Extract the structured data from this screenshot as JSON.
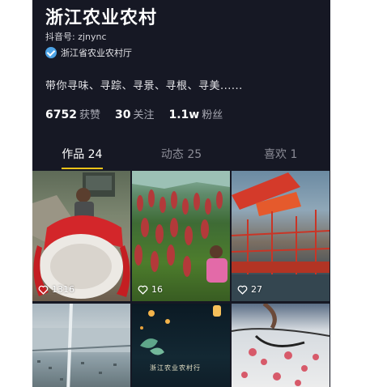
{
  "profile": {
    "name": "浙江农业农村",
    "douyin_id": "抖音号: zjnync",
    "verified_label": "浙江省农业农村厅",
    "bio": "带你寻味、寻踪、寻景、寻根、寻美......"
  },
  "stats": [
    {
      "value": "6752",
      "label": "获赞"
    },
    {
      "value": "30",
      "label": "关注"
    },
    {
      "value": "1.1w",
      "label": "粉丝"
    }
  ],
  "tabs": [
    {
      "label": "作品 24",
      "active": true
    },
    {
      "label": "动态 25",
      "active": false
    },
    {
      "label": "喜欢 1",
      "active": false
    }
  ],
  "videos": [
    {
      "likes": "1316",
      "show_likes": true,
      "subject": "farmer with cabbage"
    },
    {
      "likes": "16",
      "show_likes": true,
      "subject": "sorghum field"
    },
    {
      "likes": "27",
      "show_likes": true,
      "subject": "fishing boats with red flags"
    },
    {
      "likes": "",
      "show_likes": false,
      "subject": "aerial bridge"
    },
    {
      "likes": "",
      "show_likes": false,
      "subject": "night lanterns",
      "overlay_text": "浙江农业农村行"
    },
    {
      "likes": "",
      "show_likes": false,
      "subject": "ink painting"
    }
  ],
  "colors": {
    "background": "#161824",
    "tab_indicator": "#f5c418",
    "verified_badge": "#4da3e6"
  },
  "icons": {
    "verified": "check-badge-icon",
    "like": "heart-outline-icon"
  }
}
